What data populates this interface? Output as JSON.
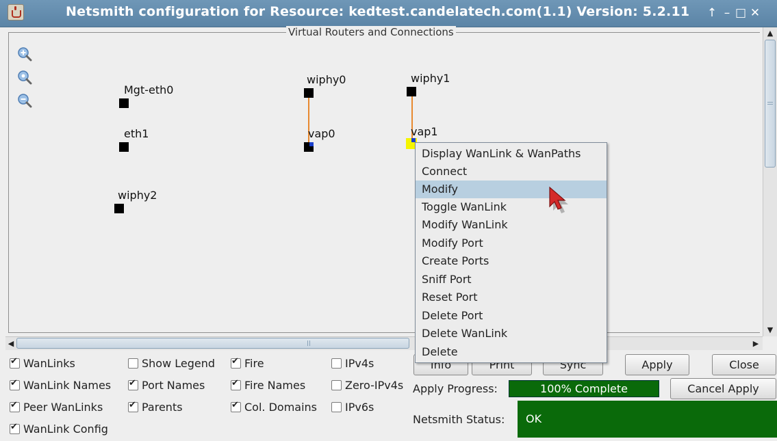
{
  "window": {
    "title": "Netsmith configuration for Resource:  kedtest.candelatech.com(1.1)  Version: 5.2.11",
    "controls": [
      "↑",
      "–",
      "□",
      "✕"
    ]
  },
  "canvas": {
    "group_title": "Virtual Routers and Connections",
    "nodes": [
      {
        "label": "Mgt-eth0"
      },
      {
        "label": "eth1"
      },
      {
        "label": "wiphy2"
      },
      {
        "label": "wiphy0"
      },
      {
        "label": "vap0"
      },
      {
        "label": "wiphy1"
      },
      {
        "label": "vap1"
      }
    ]
  },
  "context_menu": {
    "items": [
      "Display WanLink & WanPaths",
      "Connect",
      "Modify",
      "Toggle WanLink",
      "Modify WanLink",
      "Modify Port",
      "Create Ports",
      "Sniff Port",
      "Reset Port",
      "Delete Port",
      "Delete WanLink",
      "Delete"
    ],
    "highlighted": "Modify"
  },
  "options": {
    "col1": [
      {
        "label": "WanLinks",
        "checked": true
      },
      {
        "label": "WanLink Names",
        "checked": true
      },
      {
        "label": "Peer WanLinks",
        "checked": true
      },
      {
        "label": "WanLink Config",
        "checked": true
      }
    ],
    "col2": [
      {
        "label": "Show Legend",
        "checked": false
      },
      {
        "label": "Port Names",
        "checked": true
      },
      {
        "label": "Parents",
        "checked": true
      }
    ],
    "col3": [
      {
        "label": "Fire",
        "checked": true
      },
      {
        "label": "Fire Names",
        "checked": true
      },
      {
        "label": "Col. Domains",
        "checked": true
      }
    ],
    "col4": [
      {
        "label": "IPv4s",
        "checked": false
      },
      {
        "label": "Zero-IPv4s",
        "checked": false
      },
      {
        "label": "IPv6s",
        "checked": false
      }
    ]
  },
  "buttons": {
    "info": "Info",
    "print": "Print",
    "sync": "Sync",
    "apply": "Apply",
    "close": "Close",
    "cancel_apply": "Cancel Apply"
  },
  "status": {
    "apply_progress_label": "Apply Progress:",
    "apply_progress_value": "100% Complete",
    "netsmith_status_label": "Netsmith Status:",
    "netsmith_status_value": "OK"
  },
  "colors": {
    "titlebar": "#5b84a6",
    "link": "#e8892f",
    "status_green": "#0a6a0a",
    "menu_highlight": "#b8cfe0",
    "cursor_red": "#d42a2a"
  }
}
